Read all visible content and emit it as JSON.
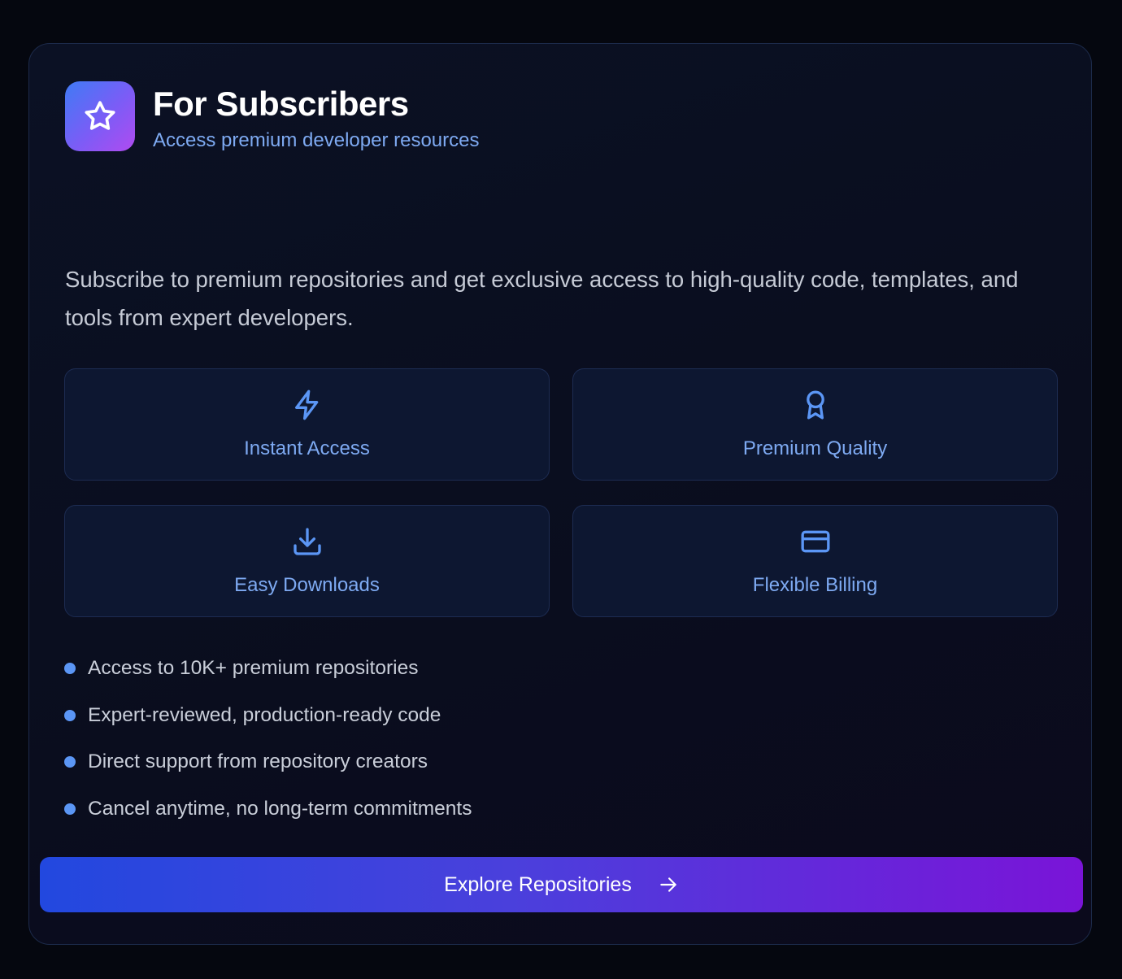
{
  "header": {
    "title": "For Subscribers",
    "subtitle": "Access premium developer resources",
    "logo_icon": "star-icon"
  },
  "description": "Subscribe to premium repositories and get exclusive access to high-quality code, templates, and tools from expert developers.",
  "features": [
    {
      "label": "Instant Access",
      "icon": "lightning-icon"
    },
    {
      "label": "Premium Quality",
      "icon": "award-icon"
    },
    {
      "label": "Easy Downloads",
      "icon": "download-icon"
    },
    {
      "label": "Flexible Billing",
      "icon": "credit-card-icon"
    }
  ],
  "benefits": [
    "Access to 10K+ premium repositories",
    "Expert-reviewed, production-ready code",
    "Direct support from repository creators",
    "Cancel anytime, no long-term commitments"
  ],
  "cta": {
    "label": "Explore Repositories",
    "icon": "arrow-right-icon"
  },
  "colors": {
    "background": "#05070f",
    "card": "#0a0e1f",
    "accent_text": "#7eaaf2",
    "bullet": "#5b96f5",
    "gradient_start": "#2248df",
    "gradient_end": "#7a14d8"
  }
}
